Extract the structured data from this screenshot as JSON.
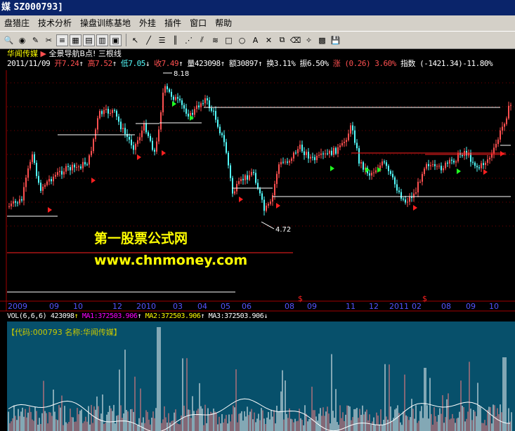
{
  "window": {
    "title_prefix": "媒",
    "title_code": "SZ000793]"
  },
  "menu": [
    "盘猎庄",
    "技术分析",
    "操盘训练基地",
    "外挂",
    "插件",
    "窗口",
    "帮助"
  ],
  "toolbar_icons": [
    "zoom-icon",
    "binoculars-icon",
    "pen-icon",
    "tool-icon",
    "list-icon",
    "grid-icon",
    "chart-icon",
    "table-icon",
    "text-icon",
    "arrow-cursor-icon",
    "line-draw-icon",
    "hline-icon",
    "vline-icon",
    "fan-icon",
    "channel-icon",
    "parallel-icon",
    "rectangle-icon",
    "ellipse-icon",
    "text-tool-icon",
    "cross-icon",
    "copy-icon",
    "eraser-icon",
    "magic-icon",
    "color-icon",
    "save-icon"
  ],
  "header": {
    "stock_name": "华闻传媒",
    "formula_name": "全景导航B点! 三根线",
    "date": "2011/11/09",
    "open_label": "开7.24",
    "high_label": "高7.52",
    "low_label": "低7.05",
    "close_label": "收7.49",
    "volume_label": "量423098",
    "amount_label": "额30897",
    "turnover_label": "换3.11%",
    "amplitude_label": "振6.50%",
    "change_label": "涨 (0.26) 3.60%",
    "index_label": "指数 (-1421.34)-11.80%"
  },
  "annotations": {
    "high_price": "8.18",
    "low_price": "4.72"
  },
  "watermark": {
    "line1": "第一股票公式网",
    "line2": "www.chnmoney.com"
  },
  "date_axis": [
    "2009",
    "09",
    "10",
    "12",
    "2010",
    "03",
    "04",
    "05",
    "06",
    "08",
    "09",
    "11",
    "12",
    "2011",
    "02",
    "08",
    "09",
    "10"
  ],
  "volume": {
    "indicator": "VOL(6,6,6)",
    "vol_value": "423098",
    "ma1": "MA1:372503.906",
    "ma2": "MA2:372503.906",
    "ma3": "MA3:372503.906",
    "code_label": "【代码:000793 名称:华闻传媒】"
  },
  "colors": {
    "up": "#ff5050",
    "down": "#54fcfc",
    "bg": "#000000",
    "vol_bg": "#07506b",
    "accent": "#ffff00"
  }
}
